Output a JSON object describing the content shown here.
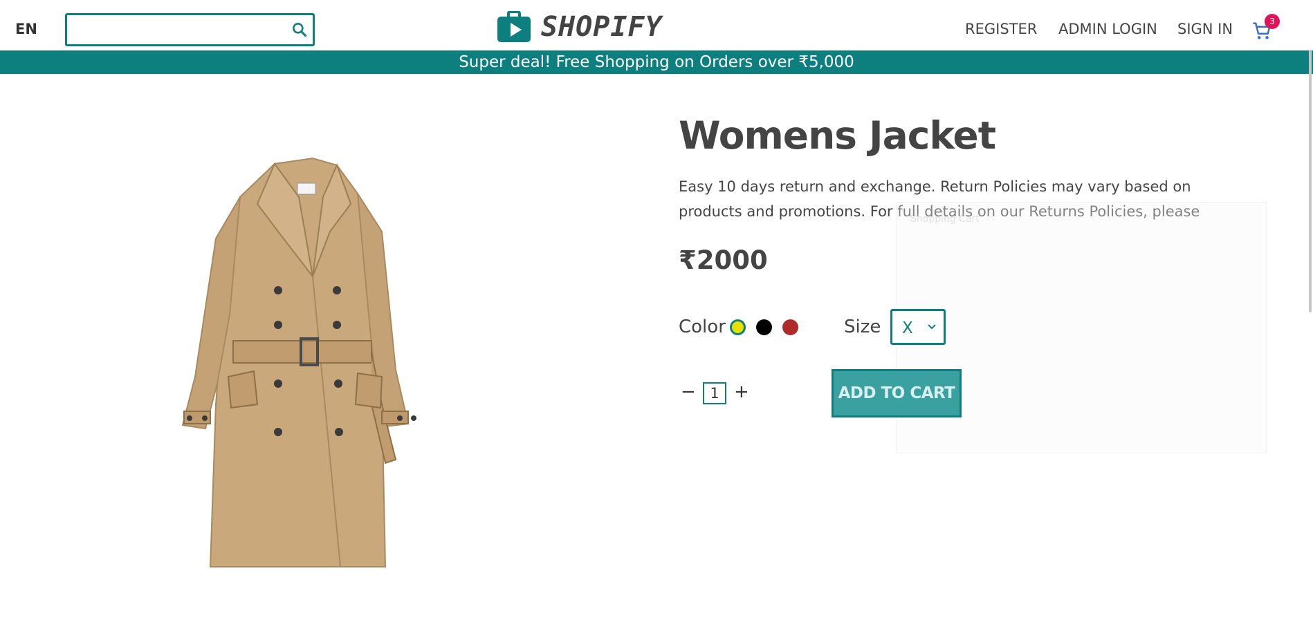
{
  "header": {
    "language": "EN",
    "search": {
      "placeholder": "",
      "value": ""
    },
    "brand": "SHOPIFY",
    "nav": {
      "register": "REGISTER",
      "admin_login": "ADMIN LOGIN",
      "sign_in": "SIGN IN"
    },
    "cart_count": "3"
  },
  "banner": "Super deal! Free Shopping on Orders over ₹5,000",
  "product": {
    "title": "Womens Jacket",
    "description": "Easy 10 days return and exchange. Return Policies may vary based on products and promotions. For full details on our Returns Policies, please",
    "price": "₹2000",
    "color_label": "Color",
    "colors": [
      "#e8e000",
      "#000000",
      "#b02a2a"
    ],
    "size_label": "Size",
    "size_value": "X",
    "quantity": "1",
    "add_to_cart": "ADD TO CART"
  },
  "ghost_panel_label": "Shopping Cart",
  "colors": {
    "accent": "#0e7f7f",
    "badge": "#e0135a",
    "button": "#3aa0a0"
  }
}
